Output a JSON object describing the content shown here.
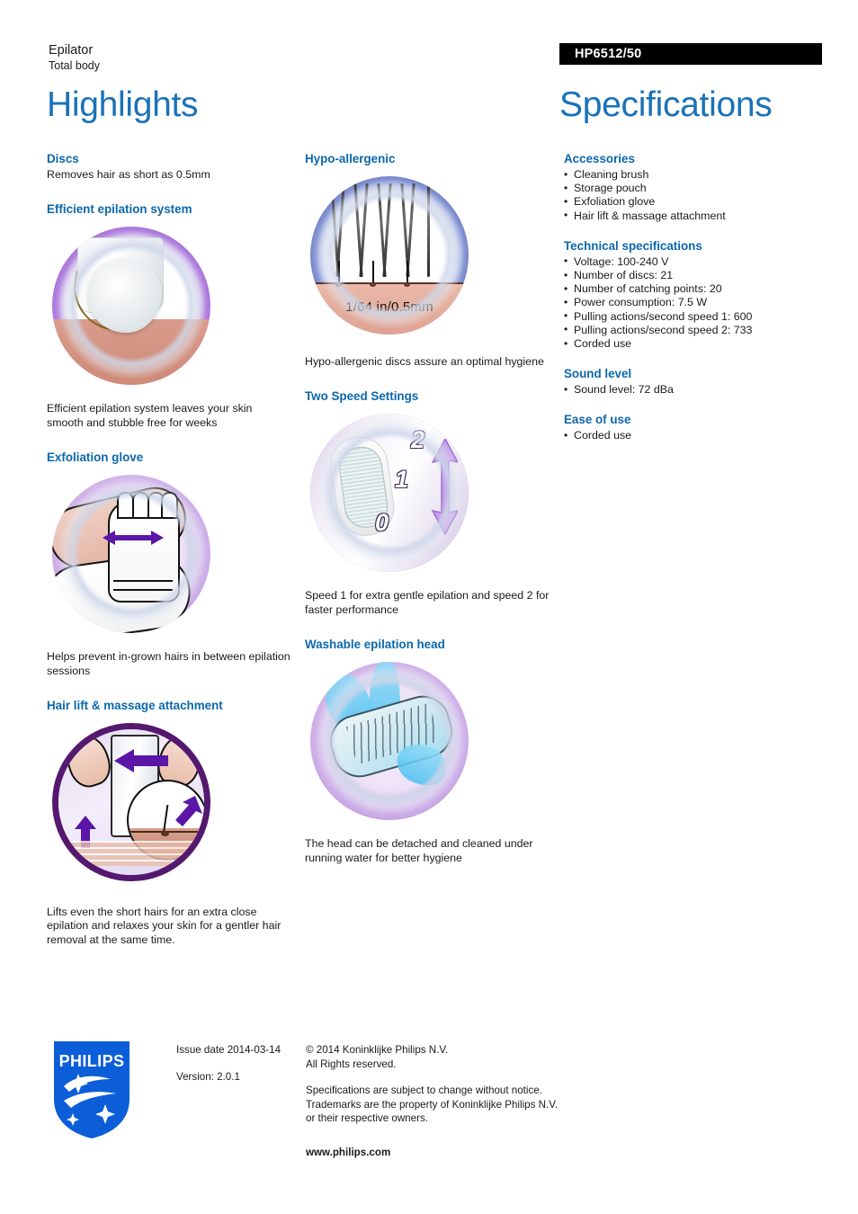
{
  "header": {
    "category": "Epilator",
    "subcategory": "Total body",
    "highlights_title": "Highlights",
    "specifications_title": "Specifications",
    "product_code": "HP6512/50",
    "accent_blue": "#1a72b8",
    "heading_blue": "#0b67ad"
  },
  "highlights": {
    "column1": [
      {
        "heading": "Discs",
        "caption": "Removes hair as short as 0.5mm",
        "has_image": false
      },
      {
        "heading": "Efficient epilation system",
        "caption": "Efficient epilation system leaves your skin smooth and stubble free for weeks",
        "has_image": true,
        "image_name": "efficient-epilation-system-illustration"
      },
      {
        "heading": "Exfoliation glove",
        "caption": "Helps prevent in-grown hairs in between epilation sessions",
        "has_image": true,
        "image_name": "exfoliation-glove-illustration"
      },
      {
        "heading": "Hair lift & massage attachment",
        "caption": "Lifts even the short hairs for an extra close epilation and relaxes your skin for a gentler hair removal at the same time.",
        "has_image": true,
        "image_name": "hair-lift-massage-illustration"
      }
    ],
    "column2": [
      {
        "heading": "Hypo-allergenic",
        "caption": "Hypo-allergenic discs assure an optimal hygiene",
        "has_image": true,
        "image_name": "hypo-allergenic-illustration",
        "image_label": "1/64 in/0.5mm"
      },
      {
        "heading": "Two Speed Settings",
        "caption": "Speed 1 for extra gentle epilation and speed 2 for faster performance",
        "has_image": true,
        "image_name": "two-speed-settings-illustration",
        "dial_numbers": [
          "2",
          "1",
          "0"
        ]
      },
      {
        "heading": "Washable epilation head",
        "caption": "The head can be detached and cleaned under running water for better hygiene",
        "has_image": true,
        "image_name": "washable-epilation-head-illustration"
      }
    ]
  },
  "specifications": [
    {
      "heading": "Accessories",
      "items": [
        "Cleaning brush",
        "Storage pouch",
        "Exfoliation glove",
        "Hair lift & massage attachment"
      ]
    },
    {
      "heading": "Technical specifications",
      "items": [
        "Voltage: 100-240 V",
        "Number of discs: 21",
        "Number of catching points: 20",
        "Power consumption: 7.5 W",
        "Pulling actions/second speed 1: 600",
        "Pulling actions/second speed 2: 733",
        "Corded use"
      ]
    },
    {
      "heading": "Sound level",
      "items": [
        "Sound level: 72 dBa"
      ]
    },
    {
      "heading": "Ease of use",
      "items": [
        "Corded use"
      ]
    }
  ],
  "footer": {
    "logo_wordmark": "PHILIPS",
    "issue_date": "Issue date 2014-03-14",
    "version": "Version: 2.0.1",
    "copyright_line1": "© 2014 Koninklijke Philips N.V.",
    "copyright_line2": "All Rights reserved.",
    "disclaimer_line1": "Specifications are subject to change without notice.",
    "disclaimer_line2": "Trademarks are the property of Koninklijke Philips N.V.",
    "disclaimer_line3": "or their respective owners.",
    "website": "www.philips.com"
  }
}
